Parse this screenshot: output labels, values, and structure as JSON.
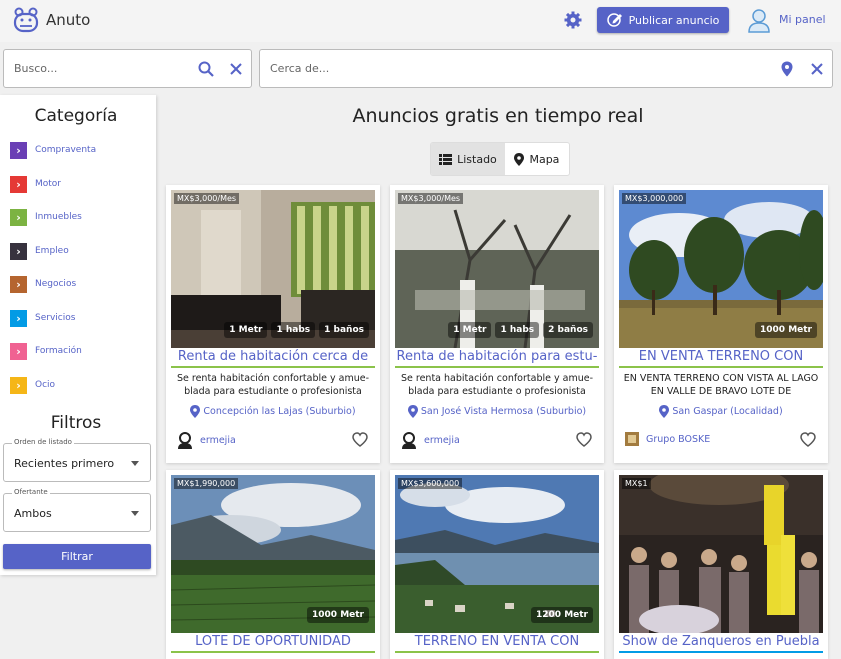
{
  "header": {
    "brand": "Anuto",
    "publish_label": "Publicar anuncio",
    "panel_label": "Mi panel"
  },
  "search": {
    "placeholder": "Busco...",
    "location_placeholder": "Cerca de..."
  },
  "sidebar": {
    "categories_title": "Categoría",
    "categories": [
      {
        "label": "Compraventa",
        "color": "#6a3fb5"
      },
      {
        "label": "Motor",
        "color": "#e53935"
      },
      {
        "label": "Inmuebles",
        "color": "#7cb342"
      },
      {
        "label": "Empleo",
        "color": "#37323e"
      },
      {
        "label": "Negocios",
        "color": "#b5652f"
      },
      {
        "label": "Servicios",
        "color": "#039be5"
      },
      {
        "label": "Formación",
        "color": "#f06292"
      },
      {
        "label": "Ocio",
        "color": "#f5b617"
      }
    ],
    "filters_title": "Filtros",
    "order_legend": "Orden de listado",
    "order_value": "Recientes primero",
    "offer_legend": "Ofertante",
    "offer_value": "Ambos",
    "filter_button": "Filtrar"
  },
  "main": {
    "title": "Anuncios gratis en tiempo real",
    "view_list": "Listado",
    "view_map": "Mapa"
  },
  "cards": [
    {
      "price": "MX$3,000/Mes",
      "chips": [
        "1 Metr",
        "1 habs",
        "1 baños"
      ],
      "title": "Renta de habitación cerca de",
      "desc": "Se renta habitación confortable y amue-blada para estudiante o profesionista",
      "location": "Concepción las Lajas (Suburbio)",
      "user": "ermejia"
    },
    {
      "price": "MX$3,000/Mes",
      "chips": [
        "1 Metr",
        "1 habs",
        "2 baños"
      ],
      "title": "Renta de habitación para estu-",
      "desc": "Se renta habitación confortable y amue-blada para estudiante o profesionista",
      "location": "San José Vista Hermosa (Suburbio)",
      "user": "ermejia"
    },
    {
      "price": "MX$3,000,000",
      "chips": [
        "1000 Metr"
      ],
      "title": "EN VENTA TERRENO CON",
      "desc": "EN VENTA TERRENO CON VISTA AL LAGO EN VALLE DE BRAVO LOTE DE",
      "location": "San Gaspar (Localidad)",
      "user": "Grupo BOSKE"
    },
    {
      "price": "MX$1,990,000",
      "chips": [
        "1000 Metr"
      ],
      "title": "LOTE DE OPORTUNIDAD",
      "desc": "",
      "location": "",
      "user": ""
    },
    {
      "price": "MX$3,600,000",
      "chips": [
        "1200 Metr"
      ],
      "title": "TERRENO EN VENTA CON",
      "desc": "",
      "location": "",
      "user": ""
    },
    {
      "price": "MX$1",
      "chips": [],
      "title": "Show de Zanqueros en Puebla",
      "desc": "",
      "location": "",
      "user": ""
    }
  ]
}
